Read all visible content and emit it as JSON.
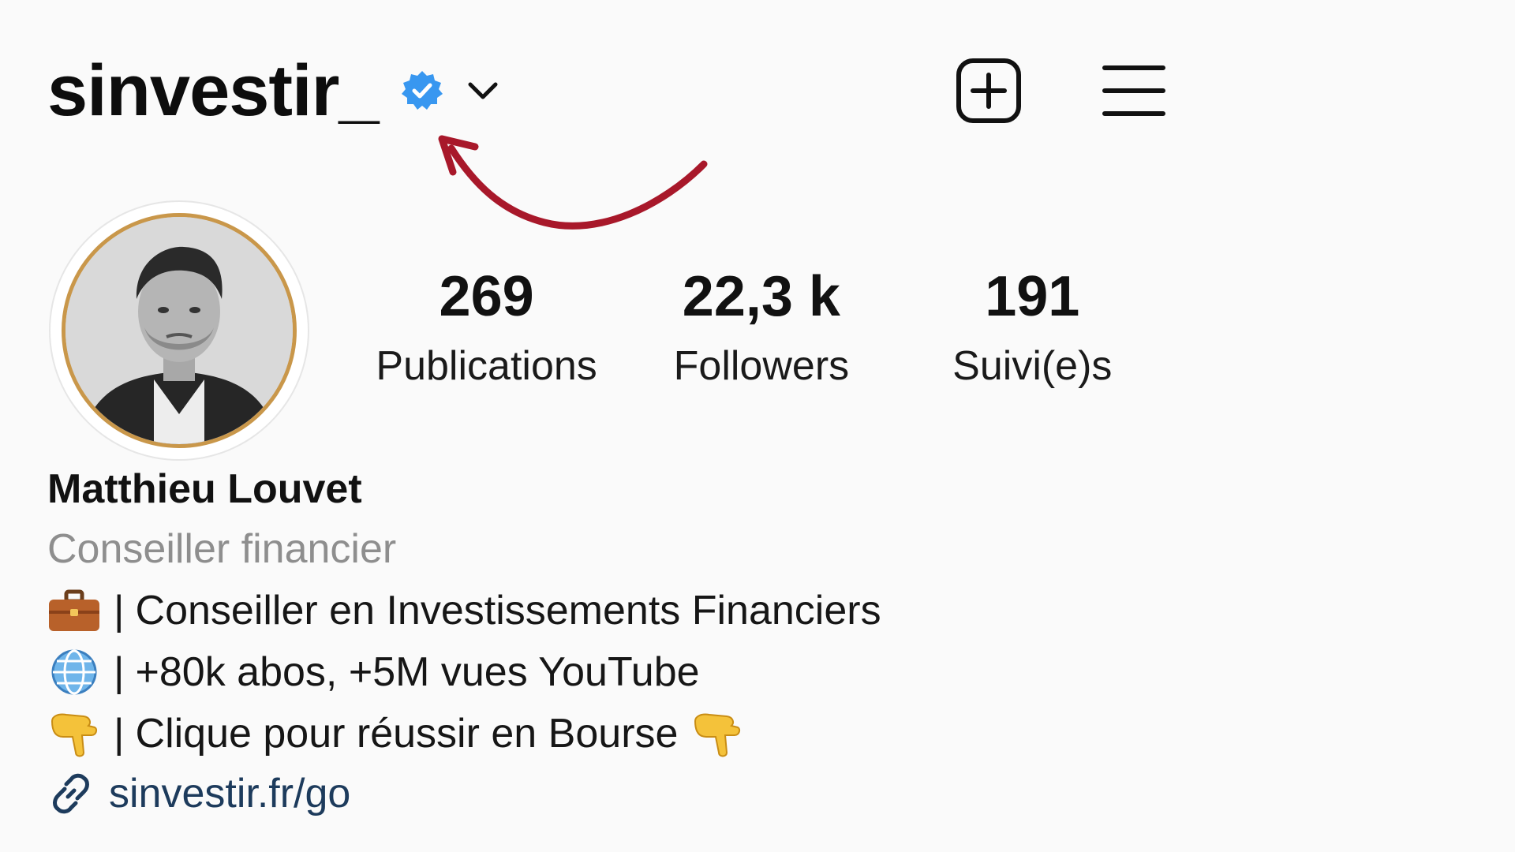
{
  "header": {
    "username": "sinvestir_",
    "verified_icon": "verified-badge-icon",
    "dropdown_icon": "chevron-down-icon",
    "new_post_icon": "plus-square-icon",
    "menu_icon": "hamburger-menu-icon"
  },
  "stats": [
    {
      "value": "269",
      "label": "Publications"
    },
    {
      "value": "22,3 k",
      "label": "Followers"
    },
    {
      "value": "191",
      "label": "Suivi(e)s"
    }
  ],
  "profile": {
    "display_name": "Matthieu Louvet",
    "category": "Conseiller financier",
    "bio_lines": [
      {
        "emoji": "briefcase-emoji",
        "separator": "|",
        "text": "Conseiller en Investissements Financiers"
      },
      {
        "emoji": "globe-emoji",
        "separator": "|",
        "text": "+80k abos, +5M vues YouTube"
      },
      {
        "emoji": "pointing-down-emoji",
        "separator": "|",
        "text": "Clique pour réussir en Bourse"
      }
    ],
    "link": "sinvestir.fr/go",
    "link_icon": "link-icon"
  },
  "colors": {
    "verified_blue": "#3897f0",
    "annotation_red": "#a8182a",
    "avatar_ring": "#c9974a",
    "category_gray": "#8e8e8e",
    "link_blue": "#1d3b5c"
  }
}
